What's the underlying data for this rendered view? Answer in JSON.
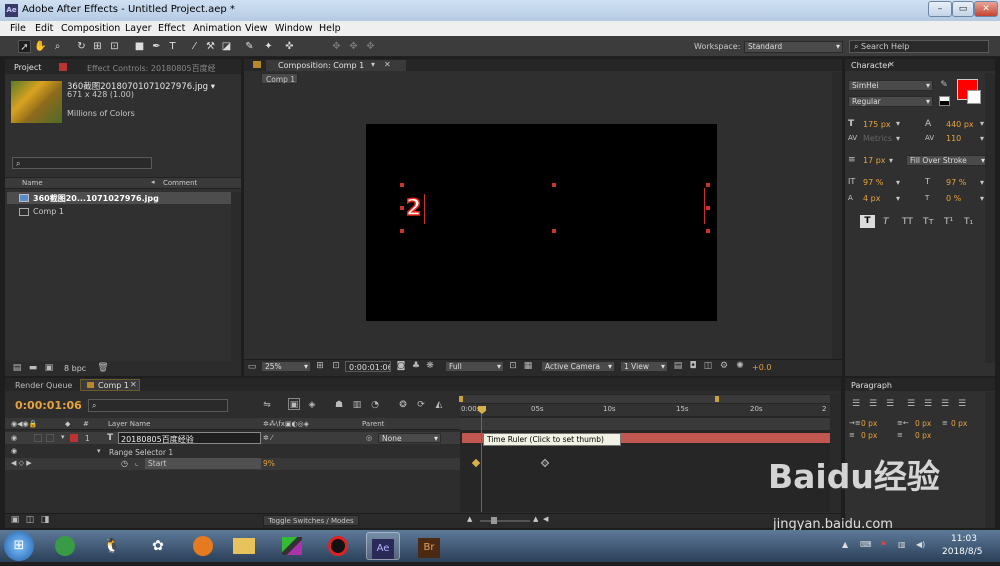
{
  "window": {
    "app_badge": "Ae",
    "title": "Adobe After Effects - Untitled Project.aep *",
    "min": "–",
    "max": "▭",
    "close": "✕"
  },
  "menu": [
    "File",
    "Edit",
    "Composition",
    "Layer",
    "Effect",
    "Animation",
    "View",
    "Window",
    "Help"
  ],
  "toolbar": {
    "workspace_label": "Workspace:",
    "workspace_value": "Standard",
    "search_help": "Search Help"
  },
  "project": {
    "tab": "Project",
    "effect_tab": "Effect Controls: 20180805百度经验",
    "footage_name": "360截图20180701071027976.jpg ▾",
    "footage_dims": "671 x 428 (1.00)",
    "footage_colors": "Millions of Colors",
    "col_name": "Name",
    "col_comment": "Comment",
    "items": [
      "360截图20...1071027976.jpg",
      "Comp 1"
    ],
    "bpc": "8 bpc"
  },
  "composition": {
    "tab": "Composition: Comp 1",
    "breadcrumb": "Comp 1",
    "text_char": "2",
    "zoom": "25%",
    "timecode": "0:00:01:06",
    "resolution": "Full",
    "camera": "Active Camera",
    "views": "1 View",
    "exposure": "+0.0"
  },
  "character": {
    "tab": "Character",
    "font": "SimHei",
    "style": "Regular",
    "size": "175 px",
    "leading": "440 px",
    "kerning": "Metrics",
    "tracking": "110",
    "stroke_width": "17 px",
    "stroke_mode": "Fill Over Stroke",
    "vscale": "97 %",
    "hscale": "97 %",
    "baseline": "4 px",
    "tsume": "0 %",
    "styles": [
      "T",
      "T",
      "TT",
      "Tт",
      "T¹",
      "T₁"
    ],
    "fill_color": "#ff0000"
  },
  "paragraph": {
    "tab": "Paragraph",
    "values": [
      "0 px",
      "0 px",
      "0 px",
      "0 px",
      "0 px"
    ]
  },
  "render_queue": {
    "tab": "Render Queue"
  },
  "timeline": {
    "tab": "Comp 1",
    "timecode": "0:00:01:06",
    "search_placeholder": "",
    "col_num": "#",
    "col_layer": "Layer Name",
    "col_parent": "Parent",
    "layer_num": "1",
    "layer_name": "20180805百度经验",
    "parent_value": "None",
    "range_selector": "Range Selector 1",
    "start_label": "Start",
    "start_value": "9%",
    "ruler_labels": [
      "0:00s",
      "05s",
      "10s",
      "15s",
      "20s",
      "2"
    ],
    "tooltip": "Time Ruler (Click to set thumb)",
    "toggle_label": "Toggle Switches / Modes"
  },
  "watermark": {
    "logo": "Baidu经验",
    "url": "jingyan.baidu.com"
  },
  "taskbar": {
    "time": "11:03",
    "date": "2018/8/5",
    "apps": [
      "ie",
      "qq",
      "media",
      "firefox",
      "explorer",
      "green-app",
      "record",
      "Ae",
      "Br"
    ]
  },
  "colors": {
    "accent": "#e8a33d",
    "layer_bar": "#c2574f",
    "keyframe": "#d8b04a"
  }
}
